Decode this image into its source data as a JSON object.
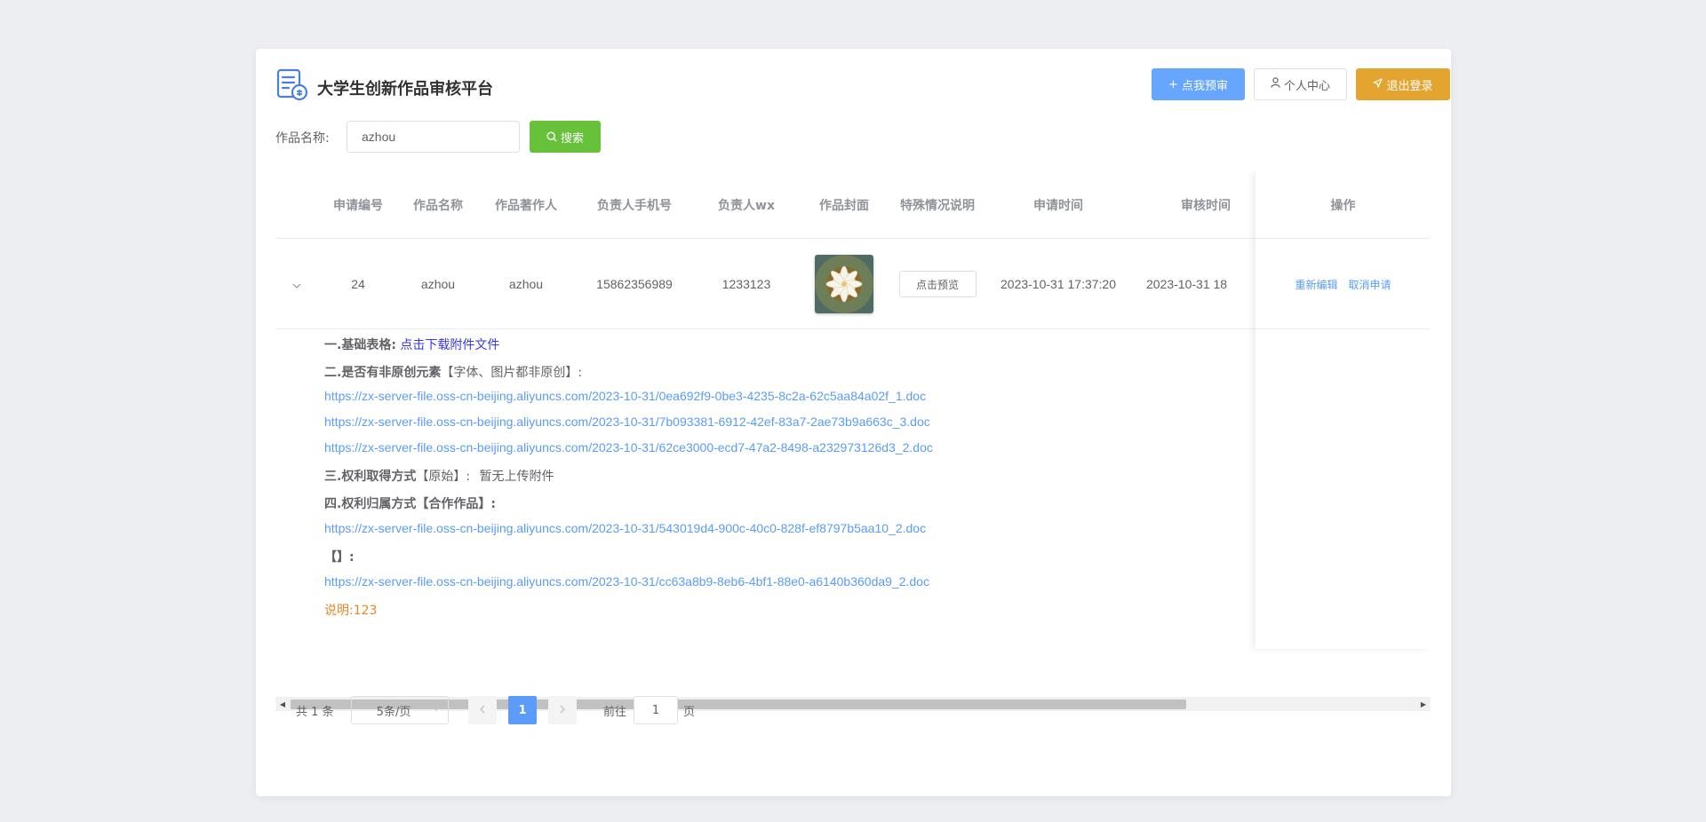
{
  "app": {
    "title": "大学生创新作品审核平台"
  },
  "header": {
    "preview_label": "点我预审",
    "center_label": "个人中心",
    "logout_label": "退出登录"
  },
  "search": {
    "label": "作品名称:",
    "value": "azhou",
    "button_label": "搜索"
  },
  "table": {
    "columns": [
      "申请编号",
      "作品名称",
      "作品著作人",
      "负责人手机号",
      "负责人wx",
      "作品封面",
      "特殊情况说明",
      "申请时间",
      "审核时间",
      "操作"
    ],
    "rows": [
      {
        "id": "24",
        "name": "azhou",
        "author": "azhou",
        "phone": "15862356989",
        "wx": "1233123",
        "special_button": "点击预览",
        "apply_time": "2023-10-31 17:37:20",
        "review_time": "2023-10-31 18",
        "op_edit": "重新编辑",
        "op_cancel": "取消申请"
      }
    ]
  },
  "expand": {
    "s1_label": "一.基础表格:",
    "s1_link": "点击下载附件文件",
    "s2_label": "二.是否有非原创元素",
    "s2_detail": "【字体、图片都非原创】:",
    "s2_urls": [
      "https://zx-server-file.oss-cn-beijing.aliyuncs.com/2023-10-31/0ea692f9-0be3-4235-8c2a-62c5aa84a02f_1.doc",
      "https://zx-server-file.oss-cn-beijing.aliyuncs.com/2023-10-31/7b093381-6912-42ef-83a7-2ae73b9a663c_3.doc",
      "https://zx-server-file.oss-cn-beijing.aliyuncs.com/2023-10-31/62ce3000-ecd7-47a2-8498-a232973126d3_2.doc"
    ],
    "s3_label": "三.权利取得方式",
    "s3_detail": "【原始】:",
    "s3_value": "暂无上传附件",
    "s4_label": "四.权利归属方式",
    "s4_detail": "【合作作品】:",
    "s4_url": "https://zx-server-file.oss-cn-beijing.aliyuncs.com/2023-10-31/543019d4-900c-40c0-828f-ef8797b5aa10_2.doc",
    "s5_label": "【】:",
    "s5_url": "https://zx-server-file.oss-cn-beijing.aliyuncs.com/2023-10-31/cc63a8b9-8eb6-4bf1-88e0-a6140b360da9_2.doc",
    "note_label": "说明:",
    "note_value": "123"
  },
  "pagination": {
    "total_text": "共 1 条",
    "page_size": "5条/页",
    "current_page": "1",
    "goto_label": "前往",
    "goto_value": "1",
    "page_unit": "页"
  },
  "colors": {
    "primary": "#5a9cf8",
    "success": "#67c23a",
    "warning": "#e3a530",
    "note": "#e6892b"
  }
}
